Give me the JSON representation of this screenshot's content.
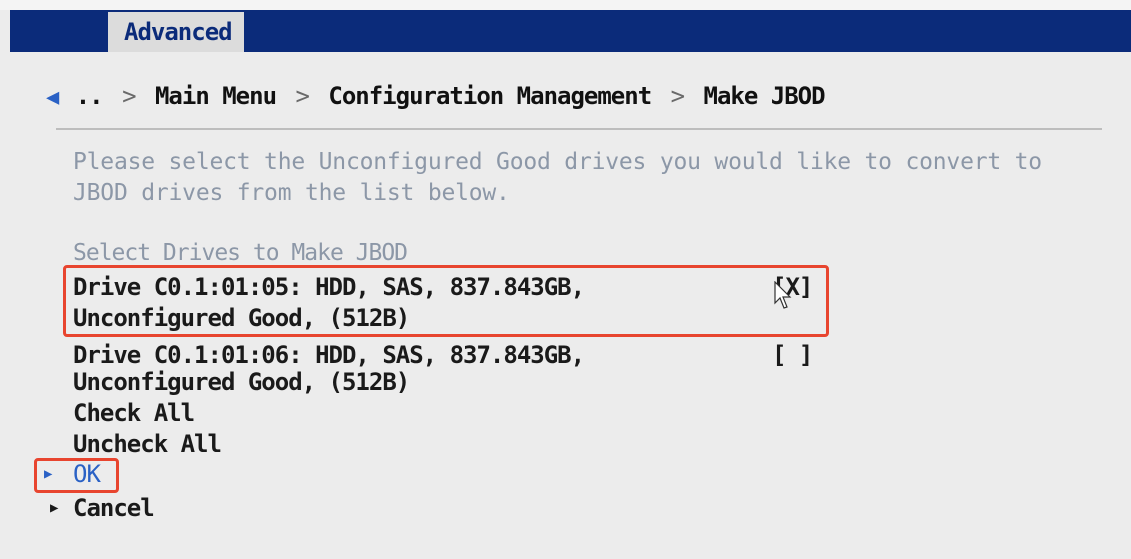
{
  "header": {
    "tab_label": "Advanced"
  },
  "breadcrumb": {
    "back_glyph": "◀",
    "items": [
      "..",
      "Main Menu",
      "Configuration Management",
      "Make JBOD"
    ],
    "separator": ">"
  },
  "help": {
    "line1": "Please select the Unconfigured Good drives you would like to convert to",
    "line2": "JBOD drives from the list below."
  },
  "section": {
    "title": "Select Drives to Make JBOD"
  },
  "drives": [
    {
      "line1": "Drive C0.1:01:05: HDD, SAS, 837.843GB,",
      "line2": "Unconfigured Good, (512B)",
      "checkbox": "[X]"
    },
    {
      "line1": "Drive C0.1:01:06: HDD, SAS, 837.843GB,",
      "line2": "Unconfigured Good, (512B)",
      "checkbox": "[ ]"
    }
  ],
  "actions": {
    "check_all": "Check All",
    "uncheck_all": "Uncheck All",
    "ok": "OK",
    "cancel": "Cancel"
  },
  "colors": {
    "header_bg": "#0b2b7a",
    "highlight": "#e8452f",
    "selected_text": "#2a61c5"
  }
}
